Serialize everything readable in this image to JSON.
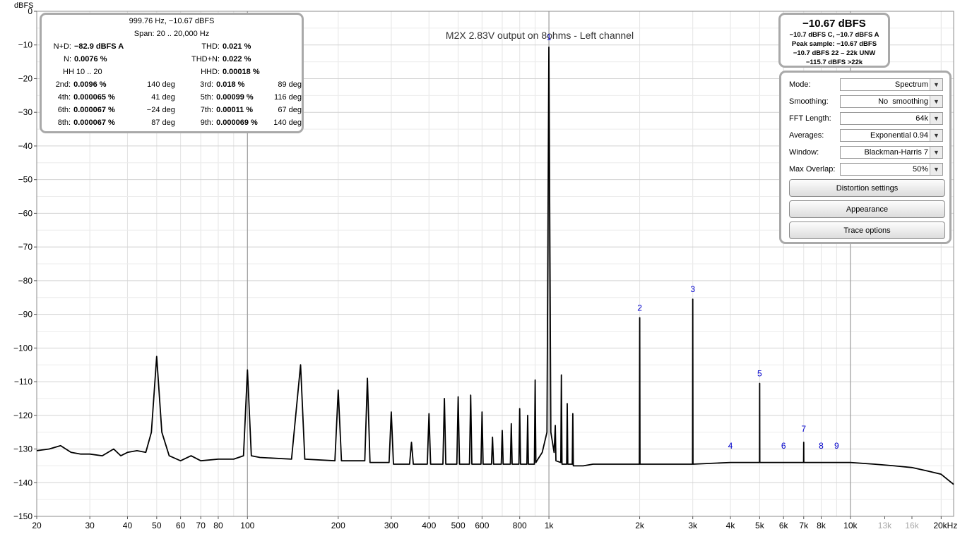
{
  "chart_data": {
    "type": "line",
    "title": "M2X 2.83V output on 8ohms - Left channel",
    "ylabel": "dBFS",
    "xlabel": "",
    "x_scale": "log",
    "xlim": [
      20,
      22000
    ],
    "ylim": [
      -150,
      0
    ],
    "grid": true,
    "y_ticks": [
      0,
      -10,
      -20,
      -30,
      -40,
      -50,
      -60,
      -70,
      -80,
      -90,
      -100,
      -110,
      -120,
      -130,
      -140,
      -150
    ],
    "x_ticks": [
      {
        "value": 20,
        "label": "20",
        "dim": false
      },
      {
        "value": 30,
        "label": "30",
        "dim": false
      },
      {
        "value": 40,
        "label": "40",
        "dim": false
      },
      {
        "value": 50,
        "label": "50",
        "dim": false
      },
      {
        "value": 60,
        "label": "60",
        "dim": false
      },
      {
        "value": 70,
        "label": "70",
        "dim": false
      },
      {
        "value": 80,
        "label": "80",
        "dim": false
      },
      {
        "value": 100,
        "label": "100",
        "dim": false
      },
      {
        "value": 200,
        "label": "200",
        "dim": false
      },
      {
        "value": 300,
        "label": "300",
        "dim": false
      },
      {
        "value": 400,
        "label": "400",
        "dim": false
      },
      {
        "value": 500,
        "label": "500",
        "dim": false
      },
      {
        "value": 600,
        "label": "600",
        "dim": false
      },
      {
        "value": 800,
        "label": "800",
        "dim": false
      },
      {
        "value": 1000,
        "label": "1k",
        "dim": false
      },
      {
        "value": 2000,
        "label": "2k",
        "dim": false
      },
      {
        "value": 3000,
        "label": "3k",
        "dim": false
      },
      {
        "value": 4000,
        "label": "4k",
        "dim": false
      },
      {
        "value": 5000,
        "label": "5k",
        "dim": false
      },
      {
        "value": 6000,
        "label": "6k",
        "dim": false
      },
      {
        "value": 7000,
        "label": "7k",
        "dim": false
      },
      {
        "value": 8000,
        "label": "8k",
        "dim": false
      },
      {
        "value": 10000,
        "label": "10k",
        "dim": false
      },
      {
        "value": 13000,
        "label": "13k",
        "dim": true
      },
      {
        "value": 16000,
        "label": "16k",
        "dim": true
      },
      {
        "value": 20000,
        "label": "20kHz",
        "dim": false
      }
    ],
    "series": [
      {
        "name": "",
        "color": "#000000",
        "points": [
          [
            20,
            -130.5
          ],
          [
            22,
            -130
          ],
          [
            24,
            -129
          ],
          [
            26,
            -131
          ],
          [
            28,
            -131.5
          ],
          [
            30,
            -131.5
          ],
          [
            33,
            -132
          ],
          [
            36,
            -130
          ],
          [
            38,
            -132
          ],
          [
            40,
            -131
          ],
          [
            43,
            -130.5
          ],
          [
            46,
            -131
          ],
          [
            48,
            -125
          ],
          [
            50,
            -102.5
          ],
          [
            52,
            -125
          ],
          [
            55,
            -132
          ],
          [
            60,
            -133.5
          ],
          [
            65,
            -132
          ],
          [
            70,
            -133.5
          ],
          [
            80,
            -133
          ],
          [
            90,
            -133
          ],
          [
            97,
            -132
          ],
          [
            100,
            -106.5
          ],
          [
            103,
            -132
          ],
          [
            110,
            -132.5
          ],
          [
            140,
            -133
          ],
          [
            150,
            -105
          ],
          [
            155,
            -133
          ],
          [
            195,
            -133.5
          ],
          [
            200,
            -112.5
          ],
          [
            205,
            -133.5
          ],
          [
            245,
            -133.5
          ],
          [
            250,
            -109
          ],
          [
            255,
            -134
          ],
          [
            295,
            -134
          ],
          [
            300,
            -119
          ],
          [
            305,
            -134.5
          ],
          [
            345,
            -134.5
          ],
          [
            350,
            -128
          ],
          [
            355,
            -134.5
          ],
          [
            395,
            -134.5
          ],
          [
            400,
            -119.5
          ],
          [
            405,
            -134.5
          ],
          [
            445,
            -134.5
          ],
          [
            450,
            -115
          ],
          [
            455,
            -134.5
          ],
          [
            495,
            -134.5
          ],
          [
            500,
            -114.5
          ],
          [
            505,
            -134.5
          ],
          [
            545,
            -134.5
          ],
          [
            550,
            -114
          ],
          [
            555,
            -134.5
          ],
          [
            595,
            -134.5
          ],
          [
            600,
            -119
          ],
          [
            605,
            -134.5
          ],
          [
            645,
            -134.5
          ],
          [
            650,
            -126.5
          ],
          [
            655,
            -134.5
          ],
          [
            695,
            -134.5
          ],
          [
            700,
            -124.5
          ],
          [
            705,
            -134.5
          ],
          [
            745,
            -134.5
          ],
          [
            750,
            -122.5
          ],
          [
            755,
            -134.5
          ],
          [
            795,
            -134.5
          ],
          [
            800,
            -118
          ],
          [
            805,
            -134.5
          ],
          [
            845,
            -134.5
          ],
          [
            850,
            -120
          ],
          [
            855,
            -134.5
          ],
          [
            895,
            -134.5
          ],
          [
            900,
            -109.5
          ],
          [
            905,
            -134
          ],
          [
            950,
            -131
          ],
          [
            985,
            -125
          ],
          [
            999.76,
            -10.67
          ],
          [
            1015,
            -125
          ],
          [
            1040,
            -131
          ],
          [
            1050,
            -123
          ],
          [
            1055,
            -133.5
          ],
          [
            1095,
            -134
          ],
          [
            1100,
            -108
          ],
          [
            1105,
            -134.5
          ],
          [
            1145,
            -134.5
          ],
          [
            1150,
            -116.5
          ],
          [
            1155,
            -134.5
          ],
          [
            1195,
            -134.5
          ],
          [
            1200,
            -119.5
          ],
          [
            1205,
            -135
          ],
          [
            1300,
            -135
          ],
          [
            1400,
            -134.5
          ],
          [
            1600,
            -134.5
          ],
          [
            1800,
            -134.5
          ],
          [
            1995,
            -134.5
          ],
          [
            2000,
            -91
          ],
          [
            2005,
            -134.5
          ],
          [
            2500,
            -134.5
          ],
          [
            2995,
            -134.5
          ],
          [
            3000,
            -85.5
          ],
          [
            3005,
            -134.5
          ],
          [
            4000,
            -134
          ],
          [
            4995,
            -134
          ],
          [
            5000,
            -110.5
          ],
          [
            5005,
            -134
          ],
          [
            6000,
            -134
          ],
          [
            6995,
            -134
          ],
          [
            7000,
            -128
          ],
          [
            7005,
            -134
          ],
          [
            8000,
            -134
          ],
          [
            10000,
            -134
          ],
          [
            12000,
            -134.5
          ],
          [
            14000,
            -135
          ],
          [
            16000,
            -135.5
          ],
          [
            18000,
            -136.5
          ],
          [
            20000,
            -137.5
          ],
          [
            22000,
            -140.5
          ]
        ]
      }
    ],
    "harmonic_markers": [
      {
        "label": "1",
        "x": 999.76,
        "y": -10.67
      },
      {
        "label": "2",
        "x": 2000,
        "y": -91
      },
      {
        "label": "3",
        "x": 3000,
        "y": -85.5
      },
      {
        "label": "4",
        "x": 4000,
        "y": -132
      },
      {
        "label": "5",
        "x": 5000,
        "y": -110.5
      },
      {
        "label": "6",
        "x": 6000,
        "y": -132
      },
      {
        "label": "7",
        "x": 7000,
        "y": -127
      },
      {
        "label": "8",
        "x": 8000,
        "y": -132
      },
      {
        "label": "9",
        "x": 9000,
        "y": -132
      }
    ],
    "marker_color": "#0000cc"
  },
  "stats": {
    "line1": "999.76 Hz, −10.67 dBFS",
    "line2": "Span: 20 .. 20,000 Hz",
    "nd_label": "N+D:",
    "nd_value": "−82.9 dBFS A",
    "thd_label": "THD:",
    "thd_value": "0.021 %",
    "n_label": "N:",
    "n_value": "0.0076 %",
    "thdn_label": "THD+N:",
    "thdn_value": "0.022 %",
    "hh_label": "HH 10 .. 20",
    "hhd_label": "HHD:",
    "hhd_value": "0.00018 %",
    "harmonics": [
      {
        "l1": "2nd:",
        "v1": "0.0096 %",
        "p1": "140 deg",
        "l2": "3rd:",
        "v2": "0.018 %",
        "p2": "89 deg"
      },
      {
        "l1": "4th:",
        "v1": "0.000065 %",
        "p1": "41 deg",
        "l2": "5th:",
        "v2": "0.00099 %",
        "p2": "116 deg"
      },
      {
        "l1": "6th:",
        "v1": "0.000067 %",
        "p1": "−24 deg",
        "l2": "7th:",
        "v2": "0.00011 %",
        "p2": "67 deg"
      },
      {
        "l1": "8th:",
        "v1": "0.000067 %",
        "p1": "87 deg",
        "l2": "9th:",
        "v2": "0.000069 %",
        "p2": "140 deg"
      }
    ]
  },
  "level": {
    "main": "−10.67 dBFS",
    "l1": "−10.7 dBFS C, −10.7 dBFS A",
    "l2": "Peak sample: −10.67 dBFS",
    "l3": "−10.7 dBFS 22 – 22k UNW",
    "l4": "−115.7 dBFS >22k"
  },
  "settings": {
    "rows": [
      {
        "label": "Mode:",
        "value": "Spectrum"
      },
      {
        "label": "Smoothing:",
        "value": "No  smoothing"
      },
      {
        "label": "FFT Length:",
        "value": "64k"
      },
      {
        "label": "Averages:",
        "value": "Exponential 0.94"
      },
      {
        "label": "Window:",
        "value": "Blackman-Harris 7"
      },
      {
        "label": "Max Overlap:",
        "value": "50%"
      }
    ],
    "buttons": {
      "distortion": "Distortion settings",
      "appearance": "Appearance",
      "trace": "Trace options"
    }
  }
}
